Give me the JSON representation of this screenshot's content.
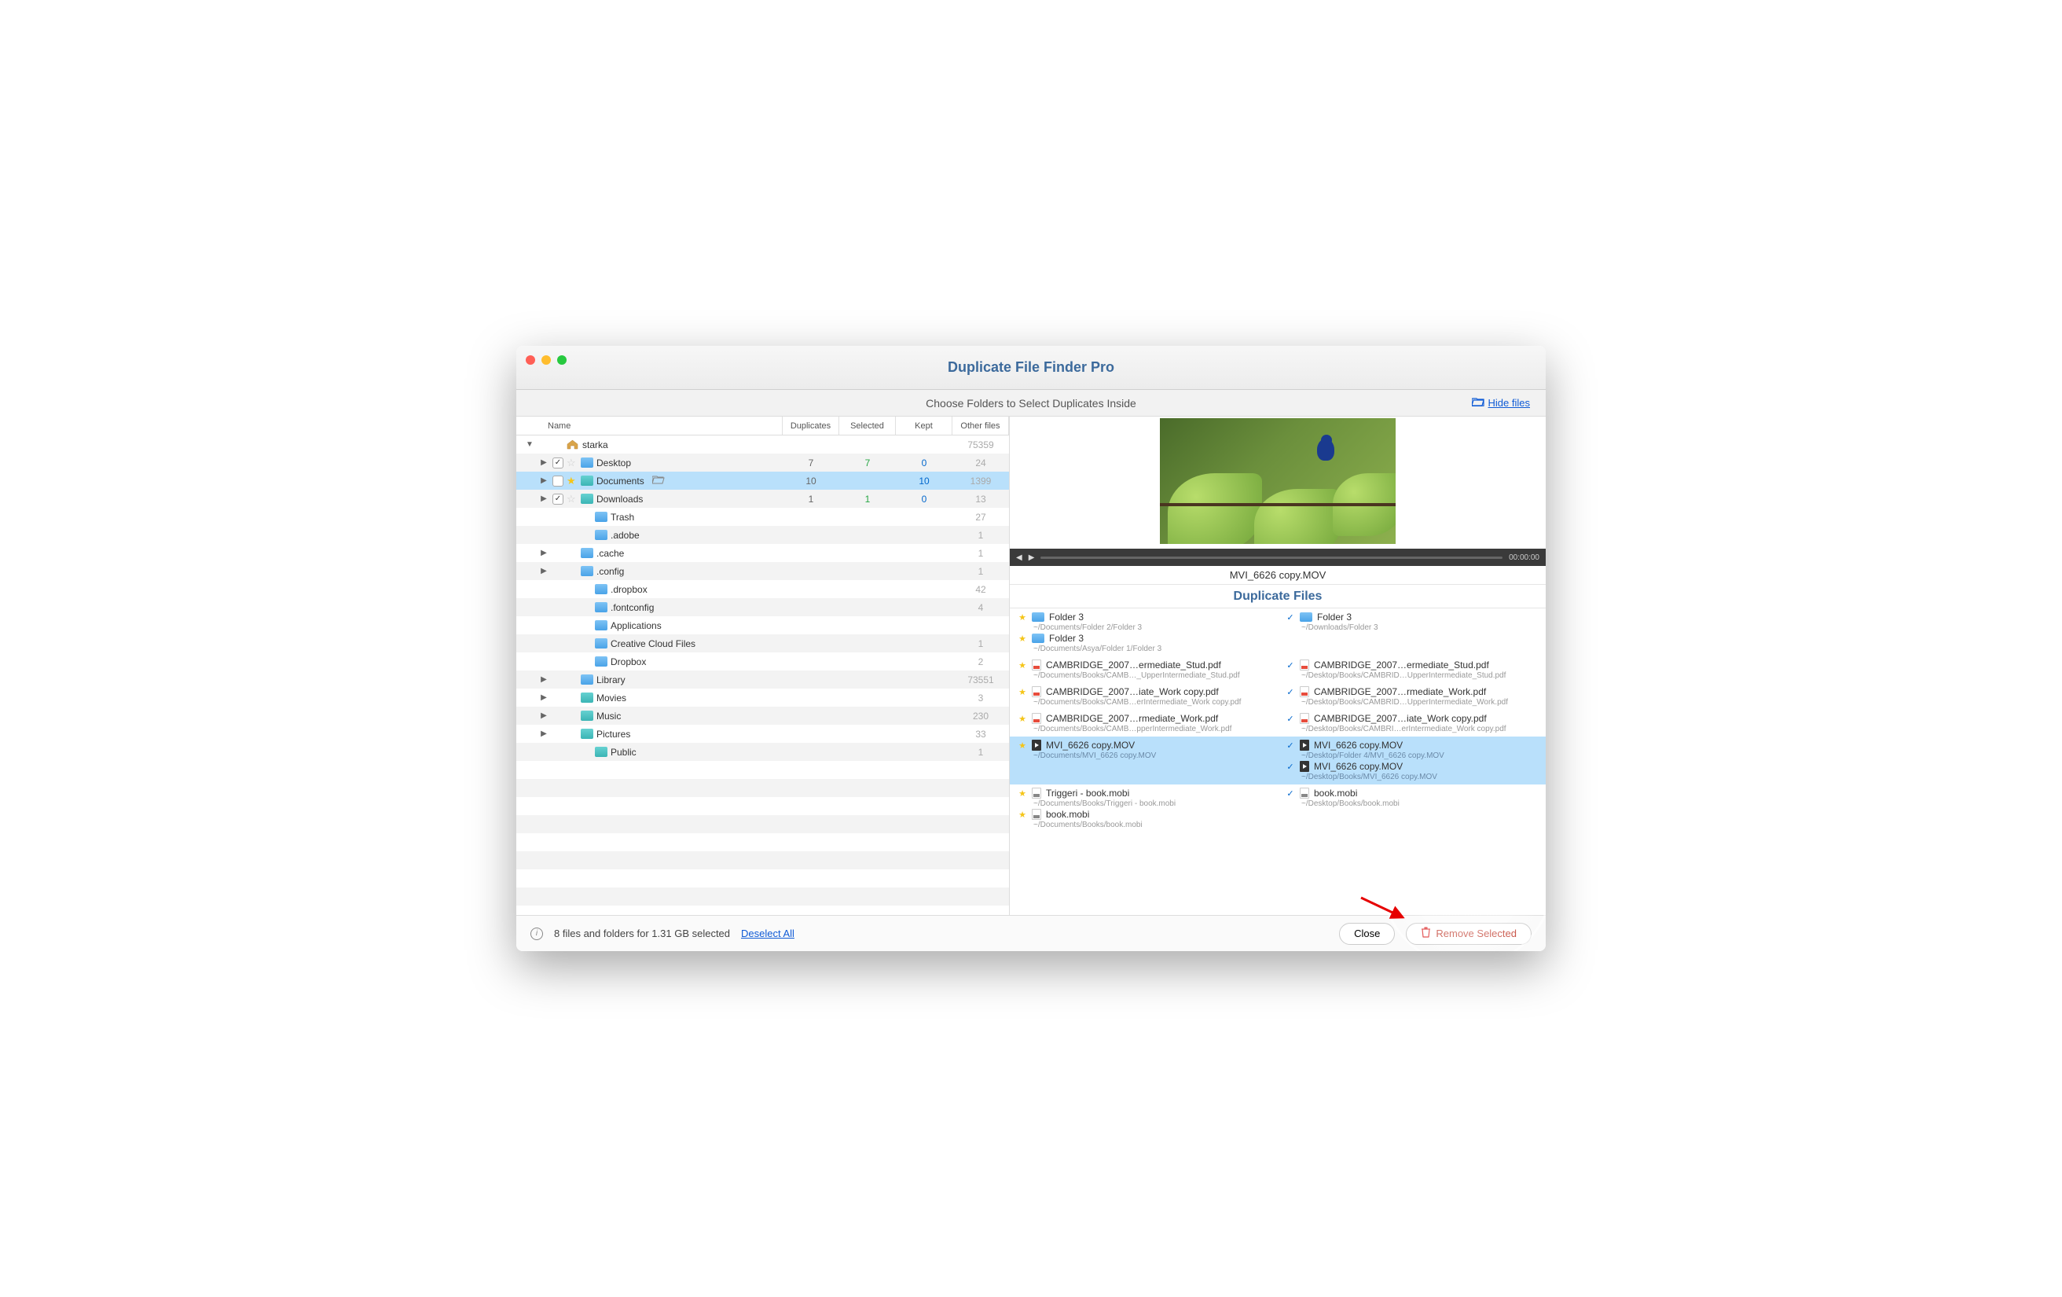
{
  "title": "Duplicate File Finder Pro",
  "subtitle": "Choose Folders to Select Duplicates Inside",
  "hide_files": "Hide files",
  "columns": {
    "name": "Name",
    "duplicates": "Duplicates",
    "selected": "Selected",
    "kept": "Kept",
    "other": "Other files"
  },
  "tree": [
    {
      "indent": 0,
      "disclosure": "down",
      "icon": "home",
      "name": "starka",
      "other": "75359"
    },
    {
      "indent": 1,
      "disclosure": "right",
      "chk": true,
      "chkval": true,
      "star": true,
      "starfill": false,
      "icon": "blue",
      "name": "Desktop",
      "dup": "7",
      "sel": "7",
      "kept": "0",
      "other": "24"
    },
    {
      "indent": 1,
      "disclosure": "right",
      "chk": true,
      "chkval": false,
      "star": true,
      "starfill": true,
      "icon": "teal",
      "name": "Documents",
      "open": true,
      "dup": "10",
      "sel": "",
      "kept": "10",
      "other": "1399",
      "rowsel": true
    },
    {
      "indent": 1,
      "disclosure": "right",
      "chk": true,
      "chkval": true,
      "star": true,
      "starfill": false,
      "icon": "teal",
      "name": "Downloads",
      "dup": "1",
      "sel": "1",
      "kept": "0",
      "other": "13"
    },
    {
      "indent": 2,
      "icon": "blue",
      "name": "Trash",
      "other": "27"
    },
    {
      "indent": 2,
      "icon": "blue",
      "name": ".adobe",
      "other": "1"
    },
    {
      "indent": 1,
      "disclosure": "right",
      "icon": "blue",
      "name": ".cache",
      "other": "1"
    },
    {
      "indent": 1,
      "disclosure": "right",
      "icon": "blue",
      "name": ".config",
      "other": "1"
    },
    {
      "indent": 2,
      "icon": "blue",
      "name": ".dropbox",
      "other": "42"
    },
    {
      "indent": 2,
      "icon": "blue",
      "name": ".fontconfig",
      "other": "4"
    },
    {
      "indent": 2,
      "icon": "blue",
      "name": "Applications"
    },
    {
      "indent": 2,
      "icon": "blue",
      "name": "Creative Cloud Files",
      "other": "1"
    },
    {
      "indent": 2,
      "icon": "blue",
      "name": "Dropbox",
      "other": "2"
    },
    {
      "indent": 1,
      "disclosure": "right",
      "icon": "blue",
      "name": "Library",
      "other": "73551"
    },
    {
      "indent": 1,
      "disclosure": "right",
      "icon": "teal",
      "name": "Movies",
      "other": "3"
    },
    {
      "indent": 1,
      "disclosure": "right",
      "icon": "teal",
      "name": "Music",
      "other": "230"
    },
    {
      "indent": 1,
      "disclosure": "right",
      "icon": "teal",
      "name": "Pictures",
      "other": "33"
    },
    {
      "indent": 2,
      "icon": "teal",
      "name": "Public",
      "other": "1"
    }
  ],
  "playback_time": "00:00:00",
  "preview_filename": "MVI_6626 copy.MOV",
  "dup_heading": "Duplicate Files",
  "dup_groups": [
    {
      "left": [
        {
          "mark": "star",
          "type": "folder",
          "name": "Folder 3",
          "path": "~/Documents/Folder 2/Folder 3"
        },
        {
          "mark": "star",
          "type": "folder",
          "name": "Folder 3",
          "path": "~/Documents/Asya/Folder 1/Folder 3"
        }
      ],
      "right": [
        {
          "mark": "check",
          "type": "folder",
          "name": "Folder 3",
          "path": "~/Downloads/Folder 3"
        }
      ]
    },
    {
      "left": [
        {
          "mark": "star",
          "type": "pdf",
          "name": "CAMBRIDGE_2007…ermediate_Stud.pdf",
          "path": "~/Documents/Books/CAMB…_UpperIntermediate_Stud.pdf"
        }
      ],
      "right": [
        {
          "mark": "check",
          "type": "pdf",
          "name": "CAMBRIDGE_2007…ermediate_Stud.pdf",
          "path": "~/Desktop/Books/CAMBRID…UpperIntermediate_Stud.pdf"
        }
      ]
    },
    {
      "left": [
        {
          "mark": "star",
          "type": "pdf",
          "name": "CAMBRIDGE_2007…iate_Work copy.pdf",
          "path": "~/Documents/Books/CAMB…erIntermediate_Work copy.pdf"
        }
      ],
      "right": [
        {
          "mark": "check",
          "type": "pdf",
          "name": "CAMBRIDGE_2007…rmediate_Work.pdf",
          "path": "~/Desktop/Books/CAMBRID…UpperIntermediate_Work.pdf"
        }
      ]
    },
    {
      "left": [
        {
          "mark": "star",
          "type": "pdf",
          "name": "CAMBRIDGE_2007…rmediate_Work.pdf",
          "path": "~/Documents/Books/CAMB…pperIntermediate_Work.pdf"
        }
      ],
      "right": [
        {
          "mark": "check",
          "type": "pdf",
          "name": "CAMBRIDGE_2007…iate_Work copy.pdf",
          "path": "~/Desktop/Books/CAMBRI…erIntermediate_Work copy.pdf"
        }
      ]
    },
    {
      "selected": true,
      "left": [
        {
          "mark": "star",
          "type": "mov",
          "name": "MVI_6626 copy.MOV",
          "path": "~/Documents/MVI_6626 copy.MOV"
        }
      ],
      "right": [
        {
          "mark": "check",
          "type": "mov",
          "name": "MVI_6626 copy.MOV",
          "path": "~/Desktop/Folder 4/MVI_6626 copy.MOV"
        },
        {
          "mark": "check",
          "type": "mov",
          "name": "MVI_6626 copy.MOV",
          "path": "~/Desktop/Books/MVI_6626 copy.MOV"
        }
      ]
    },
    {
      "left": [
        {
          "mark": "star",
          "type": "mobi",
          "name": "Triggeri - book.mobi",
          "path": "~/Documents/Books/Triggeri - book.mobi"
        },
        {
          "mark": "star",
          "type": "mobi",
          "name": "book.mobi",
          "path": "~/Documents/Books/book.mobi"
        }
      ],
      "right": [
        {
          "mark": "check",
          "type": "mobi",
          "name": "book.mobi",
          "path": "~/Desktop/Books/book.mobi"
        }
      ]
    }
  ],
  "footer": {
    "status": "8 files and folders for 1.31 GB selected",
    "deselect": "Deselect All",
    "close": "Close",
    "remove": "Remove Selected"
  }
}
